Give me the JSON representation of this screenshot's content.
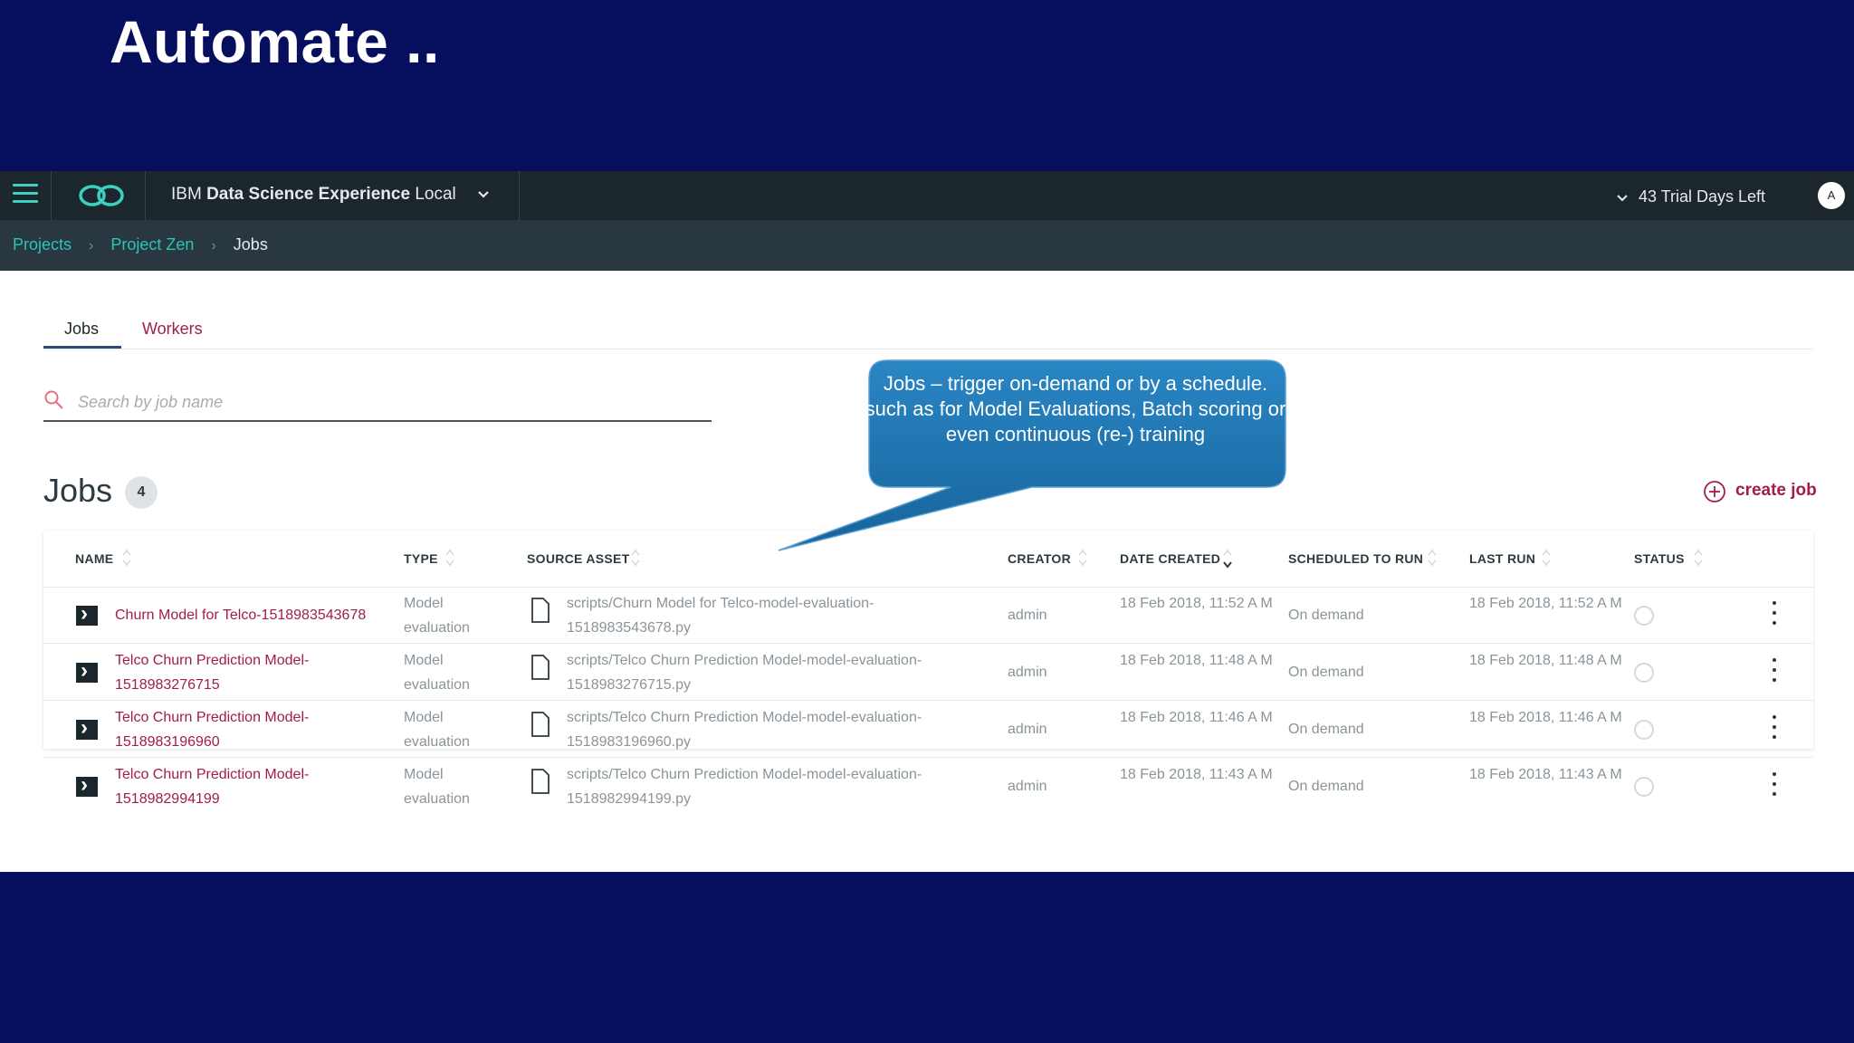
{
  "slide": {
    "title": "Automate .."
  },
  "topbar": {
    "product_prefix": "IBM",
    "product_name": "Data Science Experience",
    "product_suffix": "Local",
    "trial": "43 Trial Days Left",
    "avatar_initial": "A"
  },
  "breadcrumb": [
    "Projects",
    "Project Zen",
    "Jobs"
  ],
  "tabs": [
    "Jobs",
    "Workers"
  ],
  "search": {
    "placeholder": "Search by job name"
  },
  "section": {
    "title": "Jobs",
    "count": "4",
    "create_label": "create job"
  },
  "table": {
    "columns": [
      "NAME",
      "TYPE",
      "SOURCE ASSET",
      "CREATOR",
      "DATE CREATED",
      "SCHEDULED TO RUN",
      "LAST RUN",
      "STATUS"
    ],
    "rows": [
      {
        "name": "Churn Model for Telco-1518983543678",
        "type": "Model evaluation",
        "source": "scripts/Churn Model for Telco-model-evaluation-1518983543678.py",
        "creator": "admin",
        "date_created": "18 Feb 2018, 11:52 A M",
        "scheduled": "On demand",
        "last_run": "18 Feb 2018, 11:52 A M"
      },
      {
        "name": "Telco Churn Prediction Model-1518983276715",
        "type": "Model evaluation",
        "source": "scripts/Telco Churn Prediction Model-model-evaluation-1518983276715.py",
        "creator": "admin",
        "date_created": "18 Feb 2018, 11:48 A M",
        "scheduled": "On demand",
        "last_run": "18 Feb 2018, 11:48 A M"
      },
      {
        "name": "Telco Churn Prediction Model-1518983196960",
        "type": "Model evaluation",
        "source": "scripts/Telco Churn Prediction Model-model-evaluation-1518983196960.py",
        "creator": "admin",
        "date_created": "18 Feb 2018, 11:46 A M",
        "scheduled": "On demand",
        "last_run": "18 Feb 2018, 11:46 A M"
      },
      {
        "name": "Telco Churn Prediction Model-1518982994199",
        "type": "Model evaluation",
        "source": "scripts/Telco Churn Prediction Model-model-evaluation-1518982994199.py",
        "creator": "admin",
        "date_created": "18 Feb 2018, 11:43 A M",
        "scheduled": "On demand",
        "last_run": "18 Feb 2018, 11:43 A M"
      }
    ]
  },
  "callout": {
    "lines": [
      "Jobs – trigger on-demand or by a schedule.",
      "such as for Model Evaluations, Batch scoring or  even continuous (re-) training"
    ]
  },
  "colors": {
    "slide_background": "#050f5e",
    "topbar": "#1c272d",
    "breadcrumb_bar": "#283740",
    "accent_teal": "#2bc5b4",
    "link_magenta": "#a21d49",
    "callout_blue": "#1d6fa8"
  },
  "icons": [
    "hamburger-icon",
    "dsx-logo-icon",
    "chevron-down-icon",
    "search-icon",
    "add-circle-icon",
    "sort-icon",
    "terminal-icon",
    "file-icon",
    "status-circle-icon",
    "overflow-menu-icon"
  ]
}
